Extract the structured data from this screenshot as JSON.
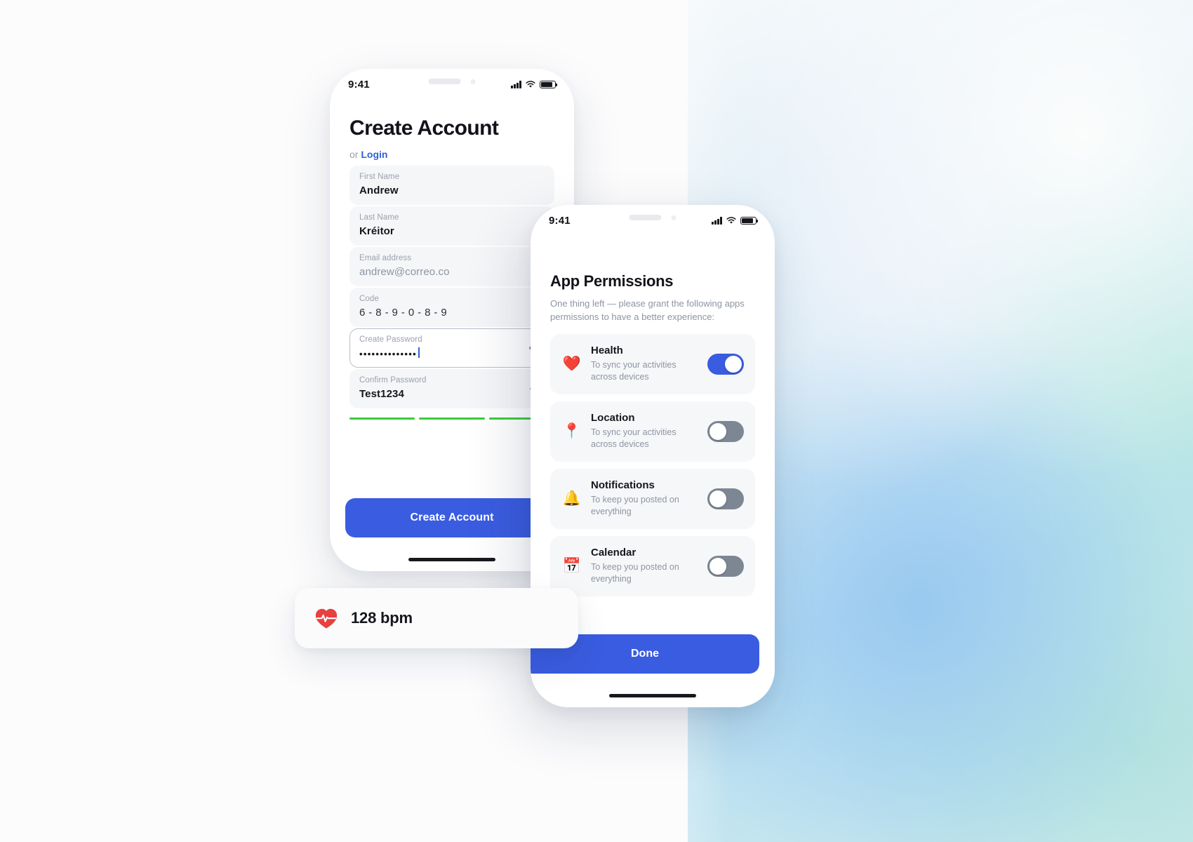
{
  "colors": {
    "primary": "#3a5ce0",
    "link": "#2f61d8",
    "strength_green": "#3ccb3c",
    "toggle_off": "#7d8794",
    "field_bg": "#f5f6f8",
    "text_primary": "#14161c",
    "text_muted": "#8d95a3"
  },
  "phone_one": {
    "status_bar": {
      "time": "9:41"
    },
    "title": "Create Account",
    "alt_prefix": "or ",
    "alt_link": "Login",
    "fields": [
      {
        "label": "First Name",
        "value": "Andrew",
        "style": "solid",
        "has_eye": false
      },
      {
        "label": "Last Name",
        "value": "Kréitor",
        "style": "solid",
        "has_eye": false
      },
      {
        "label": "Email address",
        "value": "andrew@correo.co",
        "style": "muted",
        "has_eye": false
      },
      {
        "label": "Code",
        "value": "6 - 8 - 9 - 0  - 8 - 9",
        "style": "code",
        "has_eye": false
      },
      {
        "label": "Create Password",
        "value": "••••••••••••••",
        "style": "password",
        "has_eye": true,
        "focused": true
      },
      {
        "label": "Confirm Password",
        "value": "Test1234",
        "style": "solid",
        "has_eye": true
      }
    ],
    "password_strength": {
      "segments": 3,
      "filled": 3
    },
    "submit_label": "Create Account"
  },
  "phone_two": {
    "status_bar": {
      "time": "9:41"
    },
    "title": "App Permissions",
    "subtitle": "One thing left — please grant the following apps permissions to have a better experience:",
    "permissions": [
      {
        "icon": "❤️",
        "icon_name": "health-heart-icon",
        "name": "Health",
        "desc": "To sync your activities across devices",
        "enabled": true
      },
      {
        "icon": "📍",
        "icon_name": "location-pin-icon",
        "name": "Location",
        "desc": "To sync your activities across devices",
        "enabled": false
      },
      {
        "icon": "🔔",
        "icon_name": "notification-bell-icon",
        "name": "Notifications",
        "desc": "To keep you posted on everything",
        "enabled": false
      },
      {
        "icon": "📅",
        "icon_name": "calendar-icon",
        "name": "Calendar",
        "desc": "To keep you posted on everything",
        "enabled": false
      }
    ],
    "done_label": "Done"
  },
  "bpm_widget": {
    "icon_name": "heart-rate-icon",
    "value": "128 bpm"
  }
}
